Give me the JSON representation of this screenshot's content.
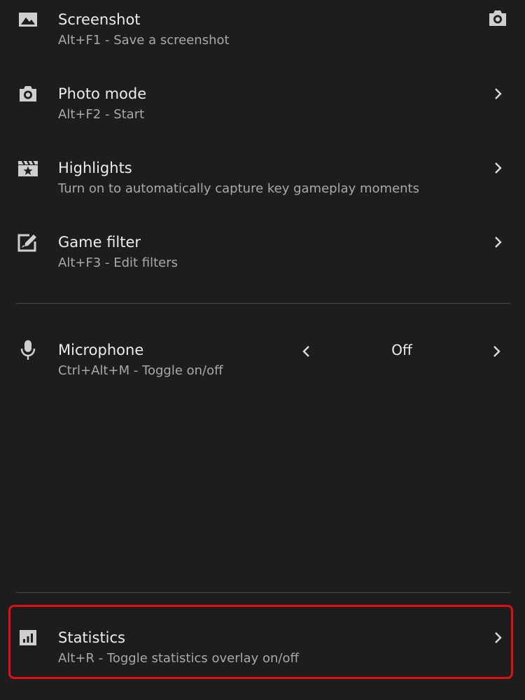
{
  "panel": {
    "rows": [
      {
        "id": "screenshot",
        "title": "Screenshot",
        "subtitle": "Alt+F1 - Save a screenshot",
        "icon": "image-icon",
        "action_icon": "camera-icon"
      },
      {
        "id": "photo-mode",
        "title": "Photo mode",
        "subtitle": "Alt+F2 - Start",
        "icon": "camera-icon",
        "action_icon": "chevron-right-icon"
      },
      {
        "id": "highlights",
        "title": "Highlights",
        "subtitle": "Turn on to automatically capture key gameplay moments",
        "icon": "clapperboard-star-icon",
        "action_icon": "chevron-right-icon"
      },
      {
        "id": "game-filter",
        "title": "Game filter",
        "subtitle": "Alt+F3 - Edit filters",
        "icon": "edit-filter-icon",
        "action_icon": "chevron-right-icon"
      }
    ],
    "microphone": {
      "title": "Microphone",
      "subtitle": "Ctrl+Alt+M - Toggle on/off",
      "value": "Off",
      "icon": "microphone-icon"
    },
    "statistics": {
      "title": "Statistics",
      "subtitle": "Alt+R - Toggle statistics overlay on/off",
      "icon": "bar-chart-icon",
      "action_icon": "chevron-right-icon"
    }
  },
  "colors": {
    "background": "#1d1d1d",
    "text": "#ececec",
    "subtext": "#a9a9a9",
    "divider": "#4a4a4a",
    "highlight_border": "#e10f14"
  }
}
